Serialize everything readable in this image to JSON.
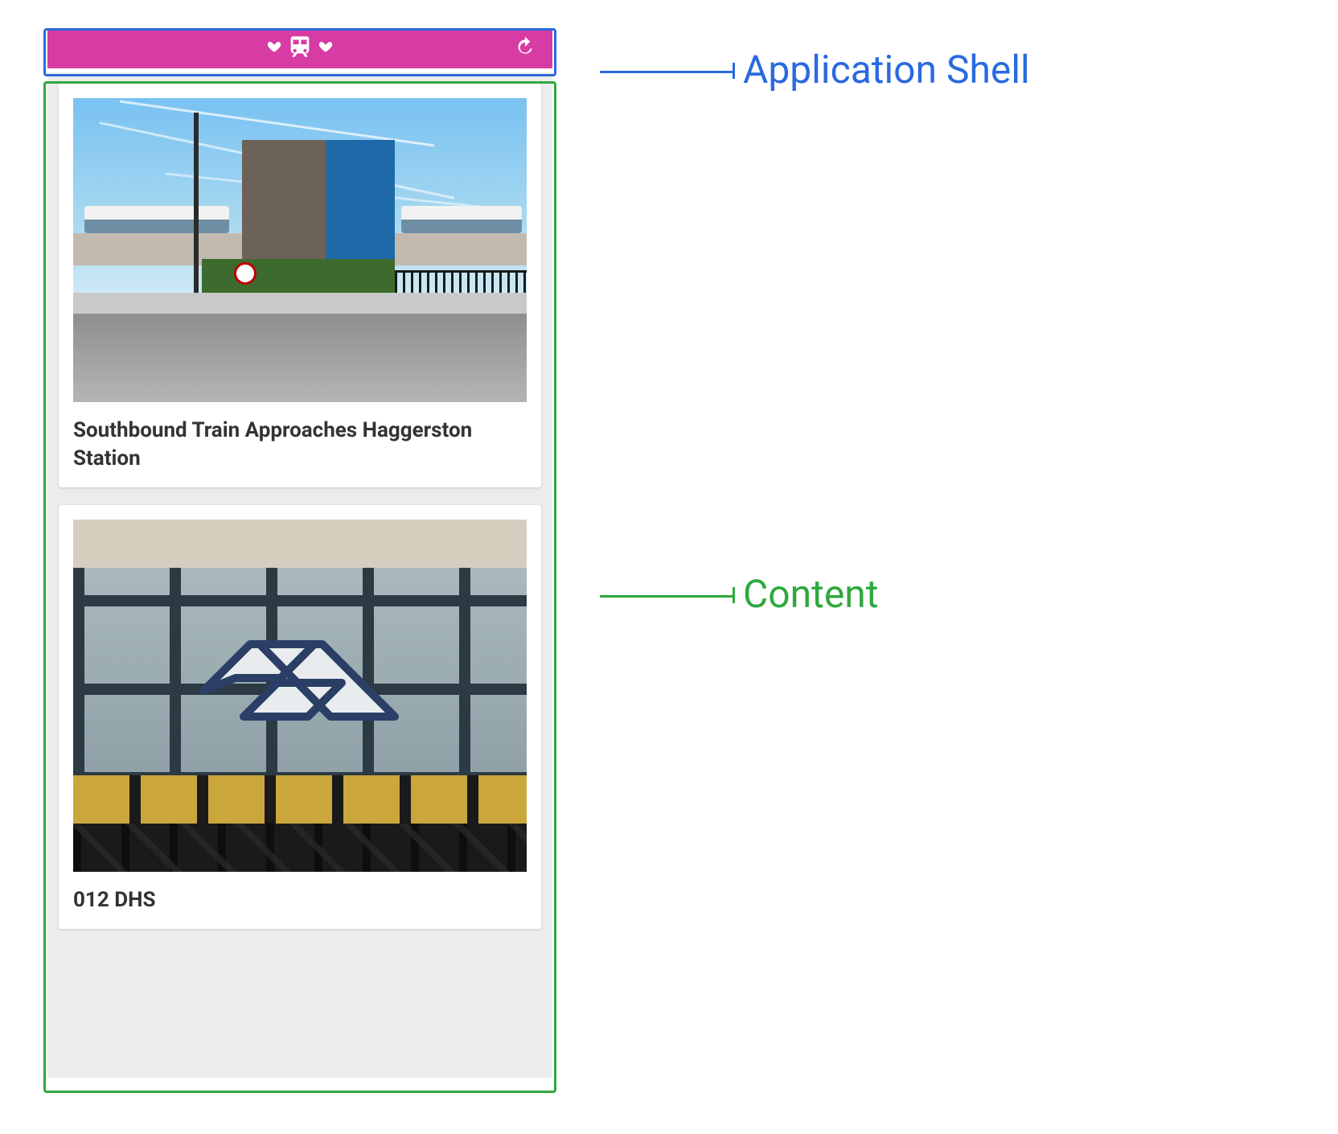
{
  "labels": {
    "shell": "Application Shell",
    "content": "Content"
  },
  "app": {
    "appbar": {
      "logo_icon": "train-hearts-icon",
      "refresh_icon": "refresh-icon"
    },
    "cards": [
      {
        "title": "Southbound Train Approaches Haggerston Station"
      },
      {
        "title": "012 DHS"
      }
    ]
  },
  "colors": {
    "shell_outline": "#2a6ae0",
    "content_outline": "#2fa83e",
    "appbar_bg": "#d63ca3"
  }
}
